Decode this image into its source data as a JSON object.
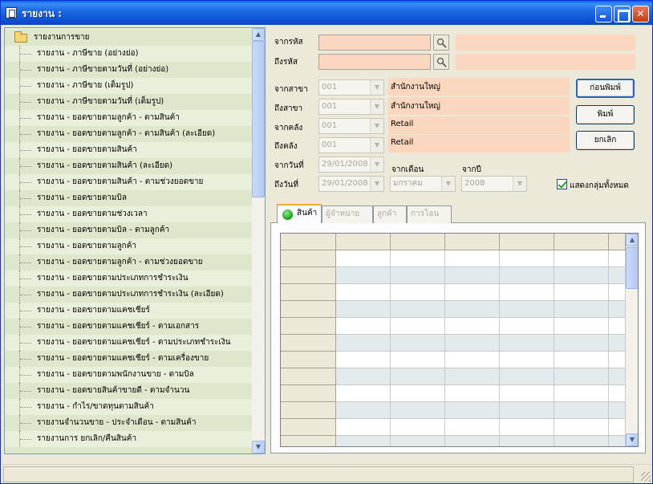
{
  "window": {
    "title": "รายงาน :",
    "colors": {
      "titlebar": "#0A5FE0",
      "peach": "#FAD7BE",
      "tree_bg": "#E8EFDA",
      "tree_alt": "#DCE7CB"
    }
  },
  "tree": {
    "root_label": "รายงานการขาย",
    "items": [
      "รายงาน - ภาษีขาย (อย่างย่อ)",
      "รายงาน - ภาษีขายตามวันที่ (อย่างย่อ)",
      "รายงาน - ภาษีขาย (เต็มรูป)",
      "รายงาน - ภาษีขายตามวันที่ (เต็มรูป)",
      "รายงาน - ยอดขายตามลูกค้า - ตามสินค้า",
      "รายงาน - ยอดขายตามลูกค้า - ตามสินค้า (ละเอียด)",
      "รายงาน - ยอดขายตามสินค้า",
      "รายงาน - ยอดขายตามสินค้า (ละเอียด)",
      "รายงาน - ยอดขายตามสินค้า - ตามช่วงยอดขาย",
      "รายงาน - ยอดขายตามบิล",
      "รายงาน - ยอดขายตามช่วงเวลา",
      "รายงาน - ยอดขายตามบิล - ตามลูกค้า",
      "รายงาน - ยอดขายตามลูกค้า",
      "รายงาน - ยอดขายตามลูกค้า - ตามช่วงยอดขาย",
      "รายงาน - ยอดขายตามประเภทการชำระเงิน",
      "รายงาน - ยอดขายตามประเภทการชำระเงิน (ละเอียด)",
      "รายงาน - ยอดขายตามแคชเชียร์",
      "รายงาน - ยอดขายตามแคชเชียร์ - ตามเอกสาร",
      "รายงาน - ยอดขายตามแคชเชียร์ - ตามประเภทชำระเงิน",
      "รายงาน - ยอดขายตามแคชเชียร์ - ตามเครื่องขาย",
      "รายงาน - ยอดขายตามพนักงานขาย - ตามบิล",
      "รายงาน - ยอดขายสินค้าขายดี - ตามจำนวน",
      "รายงาน - กำไร/ขาดทุนตามสินค้า",
      "รายงานจำนวนขาย - ประจำเดือน - ตามสินค้า",
      "รายงานการ ยกเลิก/คืนสินค้า"
    ]
  },
  "filters": {
    "from_code_label": "จากรหัส",
    "to_code_label": "ถึงรหัส",
    "from_branch_label": "จากสาขา",
    "to_branch_label": "ถึงสาขา",
    "from_warehouse_label": "จากคลัง",
    "to_warehouse_label": "ถึงคลัง",
    "from_date_label": "จากวันที่",
    "to_date_label": "ถึงวันที่",
    "from_branch_value": "001",
    "to_branch_value": "001",
    "from_warehouse_value": "001",
    "to_warehouse_value": "001",
    "from_branch_name": "สำนักงานใหญ่",
    "to_branch_name": "สำนักงานใหญ่",
    "from_warehouse_name": "Retail",
    "to_warehouse_name": "Retail",
    "from_date_value": "29/01/2008",
    "to_date_value": "29/01/2008",
    "from_month_label": "จากเดือน",
    "from_year_label": "จากปี",
    "from_month_value": "มกราคม",
    "from_year_value": "2008",
    "show_all_groups_label": "แสดงกลุ่มทั้งหมด",
    "show_all_groups_checked": true
  },
  "buttons": {
    "preview": "ก่อนพิมพ์",
    "print": "พิมพ์",
    "cancel": "ยกเลิก"
  },
  "tabs": [
    "สินค้า",
    "ผู้จำหน่าย",
    "ลูกค้า",
    "การโอน"
  ],
  "grid": {
    "visible_rows": 12
  }
}
